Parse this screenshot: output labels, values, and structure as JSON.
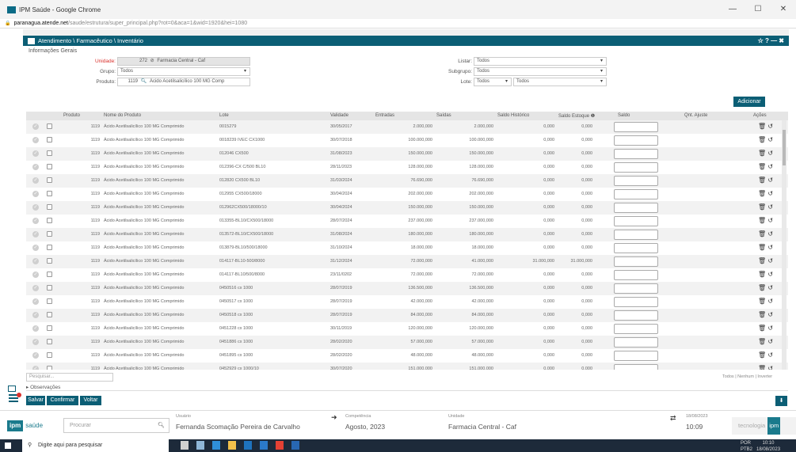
{
  "browser": {
    "title": "IPM Saúde - Google Chrome",
    "url_main": "paranagua.atende.net",
    "url_rest": "/saude/estrutura/super_principal.php?rot=0&aca=1&wid=1920&hei=1080",
    "controls": {
      "minimize": "—",
      "maximize": "☐",
      "close": "✕"
    }
  },
  "panel": {
    "breadcrumb": "Atendimento \\ Farmacêutico \\ Inventário",
    "controls": "☆ ? — ✖",
    "section": "Informações Gerais"
  },
  "form": {
    "unidade_label": "Unidade:",
    "unidade_code": "272",
    "unidade_value": "Farmacia Central - Caf",
    "grupo_label": "Grupo:",
    "grupo_value": "Todos",
    "produto_label": "Produto:",
    "produto_code": "1119",
    "produto_value": "Ácido Acetilsalicílico 100 MG Comp",
    "listar_label": "Listar:",
    "listar_value": "Todos",
    "subgrupo_label": "Subgrupo:",
    "subgrupo_value": "Todos",
    "lote_label": "Lote:",
    "lote_value": "Todos",
    "lote_value2": "Todos"
  },
  "add_button": "Adicionar",
  "table": {
    "headers": [
      "Produto",
      "Nome do Produto",
      "Lote",
      "Validade",
      "Entradas",
      "Saídas",
      "Saldo Histórico",
      "Saldo Estoque ❶",
      "Saldo",
      "Qnt. Ajuste",
      "Ações"
    ],
    "rows": [
      {
        "produto": "1119",
        "nome": "Ácido Acetilsalicílico 100 MG Comprimido",
        "lote": "0015279",
        "validade": "30/05/2017",
        "entradas": "2.000,000",
        "saidas": "2.000,000",
        "historico": "0,000",
        "estoque": "0,000"
      },
      {
        "produto": "1119",
        "nome": "Ácido Acetilsalicílico 100 MG Comprimido",
        "lote": "0018239 IVEC CX1000",
        "validade": "30/07/2018",
        "entradas": "100.000,000",
        "saidas": "100.000,000",
        "historico": "0,000",
        "estoque": "0,000"
      },
      {
        "produto": "1119",
        "nome": "Ácido Acetilsalicílico 100 MG Comprimido",
        "lote": "012046 CX500",
        "validade": "31/08/2023",
        "entradas": "150.000,000",
        "saidas": "150.000,000",
        "historico": "0,000",
        "estoque": "0,000"
      },
      {
        "produto": "1119",
        "nome": "Ácido Acetilsalicílico 100 MG Comprimido",
        "lote": "012396-CX C/500 BL10",
        "validade": "28/11/2023",
        "entradas": "128.000,000",
        "saidas": "128.000,000",
        "historico": "0,000",
        "estoque": "0,000"
      },
      {
        "produto": "1119",
        "nome": "Ácido Acetilsalicílico 100 MG Comprimido",
        "lote": "012820 CX500 BL10",
        "validade": "31/03/2024",
        "entradas": "76.690,000",
        "saidas": "76.690,000",
        "historico": "0,000",
        "estoque": "0,000"
      },
      {
        "produto": "1119",
        "nome": "Ácido Acetilsalicílico 100 MG Comprimido",
        "lote": "012955 CX500/18000",
        "validade": "30/04/2024",
        "entradas": "202.000,000",
        "saidas": "202.000,000",
        "historico": "0,000",
        "estoque": "0,000"
      },
      {
        "produto": "1119",
        "nome": "Ácido Acetilsalicílico 100 MG Comprimido",
        "lote": "012962CX500/18000/10",
        "validade": "30/04/2024",
        "entradas": "150.000,000",
        "saidas": "150.000,000",
        "historico": "0,000",
        "estoque": "0,000"
      },
      {
        "produto": "1119",
        "nome": "Ácido Acetilsalicílico 100 MG Comprimido",
        "lote": "013355-BL10/CX500/18000",
        "validade": "28/07/2024",
        "entradas": "237.000,000",
        "saidas": "237.000,000",
        "historico": "0,000",
        "estoque": "0,000"
      },
      {
        "produto": "1119",
        "nome": "Ácido Acetilsalicílico 100 MG Comprimido",
        "lote": "013572-BL10/CX500/18000",
        "validade": "31/08/2024",
        "entradas": "180.000,000",
        "saidas": "180.000,000",
        "historico": "0,000",
        "estoque": "0,000"
      },
      {
        "produto": "1119",
        "nome": "Ácido Acetilsalicílico 100 MG Comprimido",
        "lote": "013879-BL10/500/18000",
        "validade": "31/10/2024",
        "entradas": "18.000,000",
        "saidas": "18.000,000",
        "historico": "0,000",
        "estoque": "0,000"
      },
      {
        "produto": "1119",
        "nome": "Ácido Acetilsalicílico 100 MG Comprimido",
        "lote": "014117-BL10-500/8000",
        "validade": "31/12/2024",
        "entradas": "72.000,000",
        "saidas": "41.000,000",
        "historico": "31.000,000",
        "estoque": "31.000,000"
      },
      {
        "produto": "1119",
        "nome": "Ácido Acetilsalicílico 100 MG Comprimido",
        "lote": "014117-BL10/500/8000",
        "validade": "23/11/0202",
        "entradas": "72.000,000",
        "saidas": "72.000,000",
        "historico": "0,000",
        "estoque": "0,000"
      },
      {
        "produto": "1119",
        "nome": "Ácido Acetilsalicílico 100 MG Comprimido",
        "lote": "0450516 cx 1000",
        "validade": "28/07/2019",
        "entradas": "136.500,000",
        "saidas": "136.500,000",
        "historico": "0,000",
        "estoque": "0,000"
      },
      {
        "produto": "1119",
        "nome": "Ácido Acetilsalicílico 100 MG Comprimido",
        "lote": "0450517 cx 1000",
        "validade": "28/07/2019",
        "entradas": "42.000,000",
        "saidas": "42.000,000",
        "historico": "0,000",
        "estoque": "0,000"
      },
      {
        "produto": "1119",
        "nome": "Ácido Acetilsalicílico 100 MG Comprimido",
        "lote": "0450518 cx 1000",
        "validade": "28/07/2019",
        "entradas": "84.000,000",
        "saidas": "84.000,000",
        "historico": "0,000",
        "estoque": "0,000"
      },
      {
        "produto": "1119",
        "nome": "Ácido Acetilsalicílico 100 MG Comprimido",
        "lote": "0451228 cx 1000",
        "validade": "30/11/2019",
        "entradas": "120.000,000",
        "saidas": "120.000,000",
        "historico": "0,000",
        "estoque": "0,000"
      },
      {
        "produto": "1119",
        "nome": "Ácido Acetilsalicílico 100 MG Comprimido",
        "lote": "0451886 cx 1000",
        "validade": "28/02/2020",
        "entradas": "57.000,000",
        "saidas": "57.000,000",
        "historico": "0,000",
        "estoque": "0,000"
      },
      {
        "produto": "1119",
        "nome": "Ácido Acetilsalicílico 100 MG Comprimido",
        "lote": "0451895 cx 1000",
        "validade": "28/02/2020",
        "entradas": "48.000,000",
        "saidas": "48.000,000",
        "historico": "0,000",
        "estoque": "0,000"
      },
      {
        "produto": "1119",
        "nome": "Ácido Acetilsalicílico 100 MG Comprimido",
        "lote": "0452929 cx 1000/10",
        "validade": "30/07/2020",
        "entradas": "151.000,000",
        "saidas": "151.000,000",
        "historico": "0,000",
        "estoque": "0,000"
      }
    ]
  },
  "search_placeholder": "Pesquisar...",
  "select_links": "Todos | Nenhum | Inverter",
  "observacoes": "▸ Observações",
  "actions": {
    "salvar": "Salvar",
    "confirmar": "Confirmar",
    "voltar": "Voltar"
  },
  "footer": {
    "logo_ipm": "ipm",
    "logo_saude": "saúde",
    "search_placeholder": "Procurar",
    "usuario_caption": "Usuário",
    "usuario_value": "Fernanda Scomação Pereira de Carvalho",
    "competencia_caption": "Competência",
    "competencia_value": "Agosto, 2023",
    "unidade_caption": "Unidade",
    "unidade_value": "Farmacia Central - Caf",
    "date": "18/08/2023",
    "time": "10:09",
    "tecnologia": "tecnologia",
    "tecnologia_logo": "ipm"
  },
  "taskbar": {
    "search_placeholder": "Digite aqui para pesquisar",
    "lang": "POR",
    "lang2": "PTB2",
    "time": "10:10",
    "date": "18/08/2023"
  },
  "colors": {
    "accent": "#0b5e75",
    "alert": "#d9302b"
  },
  "icons": [
    "search-icon",
    "lock-icon",
    "check-circle-icon",
    "trash-icon",
    "undo-icon",
    "download-icon",
    "menu-icon",
    "transfer-icon",
    "logout-icon",
    "windows-icon"
  ]
}
